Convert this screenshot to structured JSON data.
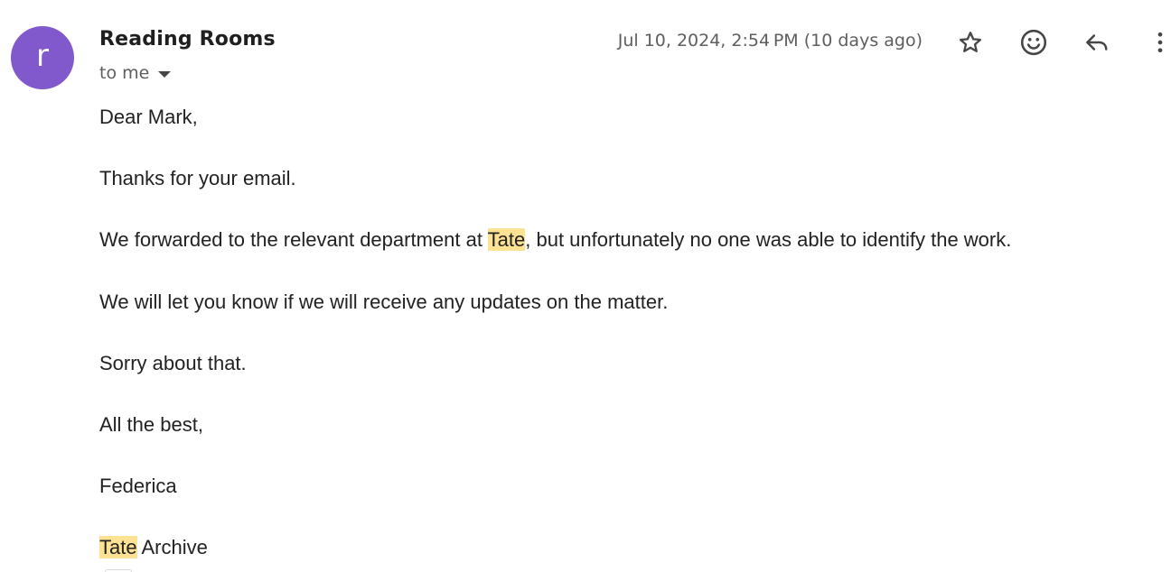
{
  "sender": {
    "avatar_letter": "r",
    "avatar_color": "#8159cc",
    "name": "Reading Rooms",
    "recipient_label": "to me"
  },
  "timestamp": "Jul 10, 2024, 2:54 PM (10 days ago)",
  "actions": [
    {
      "name": "star",
      "icon": "star-outline-icon"
    },
    {
      "name": "add-reaction",
      "icon": "emoji-icon"
    },
    {
      "name": "reply",
      "icon": "reply-icon"
    },
    {
      "name": "more",
      "icon": "more-vert-icon"
    }
  ],
  "highlight_color": "#fde293",
  "body": {
    "greeting": "Dear Mark,",
    "thanks": "Thanks for your email.",
    "forwarded": {
      "before": "We forwarded to the relevant department at ",
      "highlight": "Tate",
      "after": ", but unfortunately no one was able to identify the work."
    },
    "updates": "We will let you know if we will receive any updates on the matter.",
    "apology": "Sorry about that.",
    "closing": "All the best,",
    "signature_name": "Federica",
    "signature_org": {
      "highlight": "Tate",
      "after": " Archive"
    }
  }
}
